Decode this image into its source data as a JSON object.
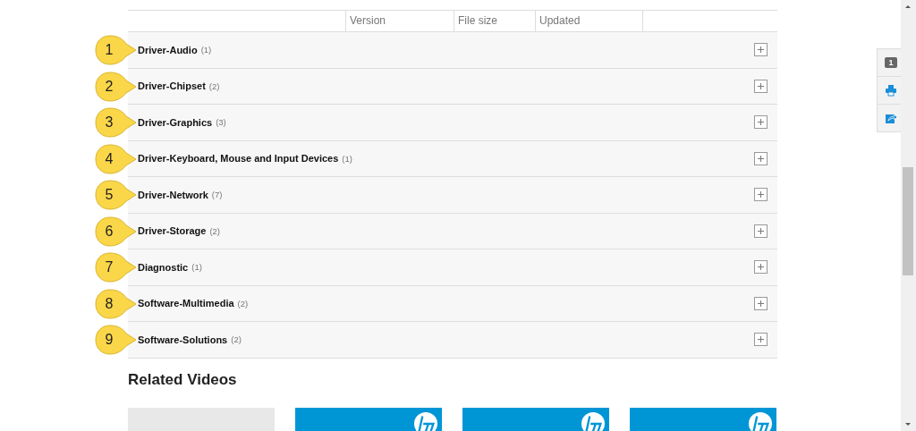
{
  "table": {
    "columns": [
      "Version",
      "File size",
      "Updated"
    ],
    "rows": [
      {
        "callout": "1",
        "title": "Driver-Audio",
        "count": "(1)",
        "expanded": false
      },
      {
        "callout": "2",
        "title": "Driver-Chipset",
        "count": "(2)",
        "expanded": false
      },
      {
        "callout": "3",
        "title": "Driver-Graphics",
        "count": "(3)",
        "expanded": false
      },
      {
        "callout": "4",
        "title": "Driver-Keyboard, Mouse and Input Devices",
        "count": "(1)",
        "expanded": false
      },
      {
        "callout": "5",
        "title": "Driver-Network",
        "count": "(7)",
        "expanded": false
      },
      {
        "callout": "6",
        "title": "Driver-Storage",
        "count": "(2)",
        "expanded": false
      },
      {
        "callout": "7",
        "title": "Diagnostic",
        "count": "(1)",
        "expanded": false
      },
      {
        "callout": "8",
        "title": "Software-Multimedia",
        "count": "(2)",
        "expanded": false
      },
      {
        "callout": "9",
        "title": "Software-Solutions",
        "count": "(2)",
        "expanded": false
      }
    ]
  },
  "side_toolbar": {
    "badge": "1"
  },
  "related_videos": {
    "heading": "Related Videos",
    "cards": [
      {
        "kind": "text"
      },
      {
        "kind": "logo"
      },
      {
        "kind": "logo"
      },
      {
        "kind": "logo"
      }
    ]
  }
}
